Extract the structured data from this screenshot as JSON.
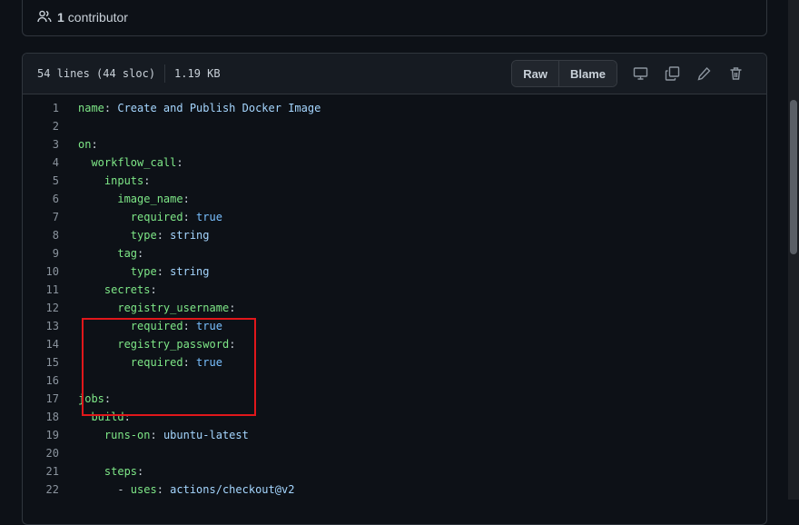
{
  "contributors": {
    "icon": "people-icon",
    "count": "1",
    "label": "contributor"
  },
  "file": {
    "lines_info": "54 lines (44 sloc)",
    "size": "1.19 KB",
    "raw_label": "Raw",
    "blame_label": "Blame",
    "tool_icons": [
      "desktop-icon",
      "copy-icon",
      "pencil-icon",
      "trash-icon"
    ]
  },
  "code_lines": [
    {
      "n": "1",
      "tokens": [
        [
          "k",
          "name"
        ],
        [
          "p",
          ": "
        ],
        [
          "v",
          "Create and Publish Docker Image"
        ]
      ]
    },
    {
      "n": "2",
      "tokens": []
    },
    {
      "n": "3",
      "tokens": [
        [
          "k",
          "on"
        ],
        [
          "p",
          ":"
        ]
      ]
    },
    {
      "n": "4",
      "tokens": [
        [
          "p",
          "  "
        ],
        [
          "k",
          "workflow_call"
        ],
        [
          "p",
          ":"
        ]
      ]
    },
    {
      "n": "5",
      "tokens": [
        [
          "p",
          "    "
        ],
        [
          "k",
          "inputs"
        ],
        [
          "p",
          ":"
        ]
      ]
    },
    {
      "n": "6",
      "tokens": [
        [
          "p",
          "      "
        ],
        [
          "k",
          "image_name"
        ],
        [
          "p",
          ":"
        ]
      ]
    },
    {
      "n": "7",
      "tokens": [
        [
          "p",
          "        "
        ],
        [
          "k",
          "required"
        ],
        [
          "p",
          ": "
        ],
        [
          "b",
          "true"
        ]
      ]
    },
    {
      "n": "8",
      "tokens": [
        [
          "p",
          "        "
        ],
        [
          "k",
          "type"
        ],
        [
          "p",
          ": "
        ],
        [
          "v",
          "string"
        ]
      ]
    },
    {
      "n": "9",
      "tokens": [
        [
          "p",
          "      "
        ],
        [
          "k",
          "tag"
        ],
        [
          "p",
          ":"
        ]
      ]
    },
    {
      "n": "10",
      "tokens": [
        [
          "p",
          "        "
        ],
        [
          "k",
          "type"
        ],
        [
          "p",
          ": "
        ],
        [
          "v",
          "string"
        ]
      ]
    },
    {
      "n": "11",
      "tokens": [
        [
          "p",
          "    "
        ],
        [
          "k",
          "secrets"
        ],
        [
          "p",
          ":"
        ]
      ]
    },
    {
      "n": "12",
      "tokens": [
        [
          "p",
          "      "
        ],
        [
          "k",
          "registry_username"
        ],
        [
          "p",
          ":"
        ]
      ]
    },
    {
      "n": "13",
      "tokens": [
        [
          "p",
          "        "
        ],
        [
          "k",
          "required"
        ],
        [
          "p",
          ": "
        ],
        [
          "b",
          "true"
        ]
      ]
    },
    {
      "n": "14",
      "tokens": [
        [
          "p",
          "      "
        ],
        [
          "k",
          "registry_password"
        ],
        [
          "p",
          ":"
        ]
      ]
    },
    {
      "n": "15",
      "tokens": [
        [
          "p",
          "        "
        ],
        [
          "k",
          "required"
        ],
        [
          "p",
          ": "
        ],
        [
          "b",
          "true"
        ]
      ]
    },
    {
      "n": "16",
      "tokens": []
    },
    {
      "n": "17",
      "tokens": [
        [
          "k",
          "jobs"
        ],
        [
          "p",
          ":"
        ]
      ]
    },
    {
      "n": "18",
      "tokens": [
        [
          "p",
          "  "
        ],
        [
          "k",
          "build"
        ],
        [
          "p",
          ":"
        ]
      ]
    },
    {
      "n": "19",
      "tokens": [
        [
          "p",
          "    "
        ],
        [
          "k",
          "runs-on"
        ],
        [
          "p",
          ": "
        ],
        [
          "v",
          "ubuntu-latest"
        ]
      ]
    },
    {
      "n": "20",
      "tokens": []
    },
    {
      "n": "21",
      "tokens": [
        [
          "p",
          "    "
        ],
        [
          "k",
          "steps"
        ],
        [
          "p",
          ":"
        ]
      ]
    },
    {
      "n": "22",
      "tokens": [
        [
          "p",
          "      - "
        ],
        [
          "k",
          "uses"
        ],
        [
          "p",
          ": "
        ],
        [
          "v",
          "actions/checkout@v2"
        ]
      ]
    }
  ],
  "colors": {
    "highlight": "#e0171b",
    "key": "#7ee787",
    "string": "#a5d6ff",
    "bool": "#79c0ff"
  }
}
